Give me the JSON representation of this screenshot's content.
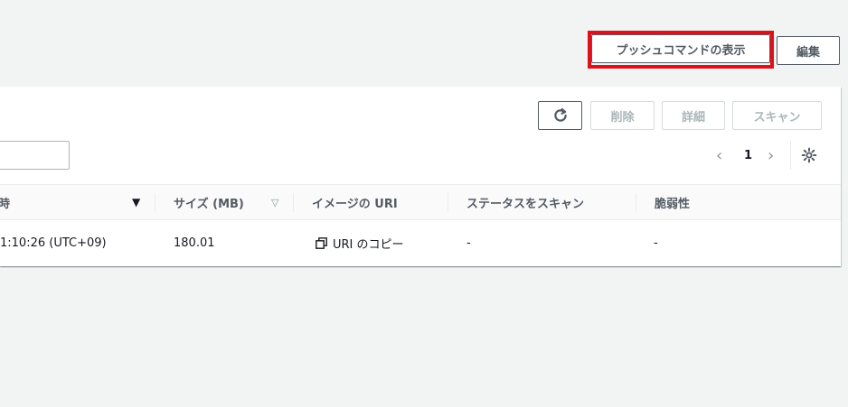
{
  "header": {
    "push_commands_label": "プッシュコマンドの表示",
    "edit_label": "編集"
  },
  "toolbar": {
    "delete_label": "削除",
    "details_label": "詳細",
    "scan_label": "スキャン"
  },
  "search": {
    "value": ""
  },
  "pagination": {
    "current_page": "1"
  },
  "table": {
    "columns": [
      "時",
      "サイズ (MB)",
      "イメージの URI",
      "ステータスをスキャン",
      "脆弱性"
    ],
    "rows": [
      {
        "pushed_at": "1:10:26 (UTC+09)",
        "size": "180.01",
        "uri_action": "URI のコピー",
        "scan_status": "-",
        "vulnerabilities": "-"
      }
    ]
  },
  "colors": {
    "highlight": "#e0101a",
    "panel_bg": "#ffffff",
    "page_bg": "#f2f3f3",
    "button_border": "#545b64"
  }
}
